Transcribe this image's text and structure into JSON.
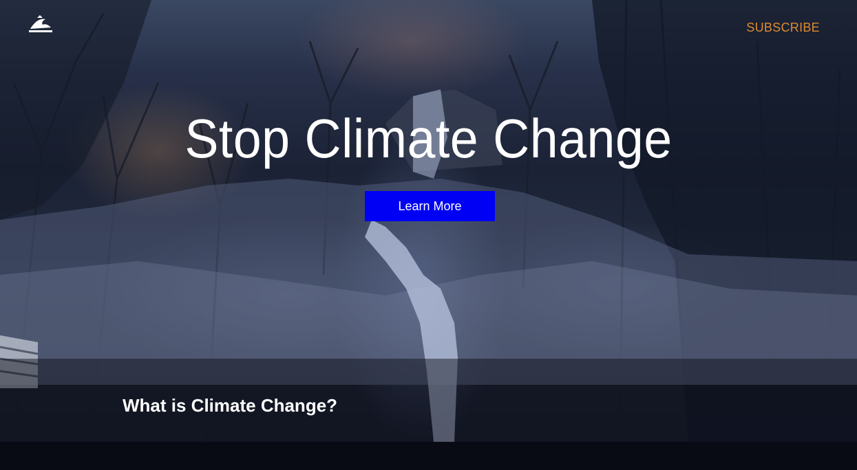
{
  "header": {
    "logo_icon": "wave-logo-icon",
    "subscribe_label": "SUBSCRIBE"
  },
  "hero": {
    "title": "Stop Climate Change",
    "cta_label": "Learn More"
  },
  "section": {
    "heading": "What is Climate Change?"
  },
  "colors": {
    "accent": "#e08a2e",
    "button": "#0000f5",
    "text": "#ffffff",
    "background": "#080a14"
  }
}
